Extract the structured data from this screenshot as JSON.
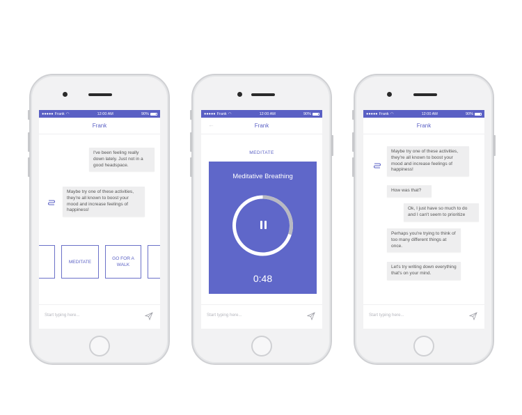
{
  "status_bar": {
    "carrier": "Frank",
    "time": "12:00 AM",
    "battery": "90%"
  },
  "contact_name": "Frank",
  "input_placeholder": "Start typing here...",
  "phone1": {
    "messages": [
      {
        "sender": "user",
        "text": "I've been feeling really down lately. Just not in a good headspace."
      },
      {
        "sender": "bot",
        "text": "Maybe try one of these activities, they're all known to boost your mood and increase feelings of happiness!"
      }
    ],
    "activities": [
      "MEDITATE",
      "GO FOR A WALK"
    ]
  },
  "phone2": {
    "section_label": "MEDITATE",
    "exercise_title": "Meditative Breathing",
    "timer": "0:48",
    "progress": 0.3
  },
  "phone3": {
    "messages": [
      {
        "sender": "bot",
        "text": "Maybe try one of these activities, they're all known to boost your mood and increase feelings of happiness!"
      },
      {
        "sender": "bot",
        "text": "How was that?"
      },
      {
        "sender": "user",
        "text": "Ok, I just have so much to do and I can't seem to prioritize"
      },
      {
        "sender": "bot",
        "text": "Perhaps you're trying to think of too many different things at once."
      },
      {
        "sender": "bot",
        "text": "Let's try writing down everything that's on your mind."
      }
    ]
  },
  "colors": {
    "accent": "#5a60c4",
    "panel": "#5f67c9",
    "bubble": "#eeeeef"
  },
  "icons": [
    "wifi-icon",
    "battery-icon",
    "back-arrow-icon",
    "bot-avatar-icon",
    "send-icon",
    "pause-icon"
  ]
}
